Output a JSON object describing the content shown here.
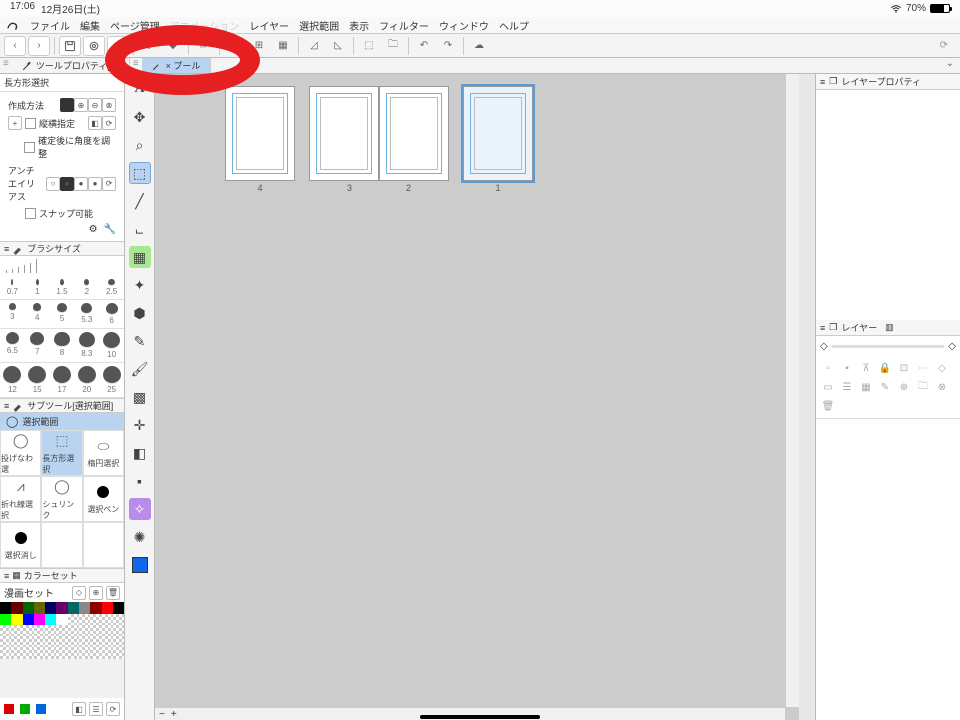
{
  "status": {
    "time": "17:06",
    "date": "12月26日(土)",
    "battery": "70%"
  },
  "menu": {
    "file": "ファイル",
    "edit": "編集",
    "page": "ページ管理",
    "anim": "アニメーション",
    "layer": "レイヤー",
    "select": "選択範囲",
    "view": "表示",
    "filter": "フィルター",
    "window": "ウィンドウ",
    "help": "ヘルプ"
  },
  "tabs": {
    "first": "ツールプロパティ[長",
    "second": "× プール"
  },
  "left": {
    "prop_title": "長方形選択",
    "method_label": "作成方法",
    "ratio_label": "縦横指定",
    "angle_label": "確定後に角度を調整",
    "aa_label": "アンチエイリアス",
    "snap_label": "スナップ可能",
    "brush_title": "ブラシサイズ",
    "sizes_txt": [
      "0.7",
      "1",
      "1.5",
      "2",
      "2.5",
      "3",
      "4",
      "5",
      "5.3",
      "6",
      "6.5",
      "7",
      "8",
      "8.3",
      "10",
      "12",
      "15",
      "17",
      "20",
      "25"
    ],
    "subtool_title": "サブツール[選択範囲]",
    "subtool_active": "選択範囲",
    "subtools": [
      "投げなわ選",
      "長方形選択",
      "楕円選択",
      "折れ線選択",
      "シュリンク",
      "選択ペン",
      "選択消し",
      "",
      ""
    ],
    "color_title": "カラーセット",
    "color_set": "漫画セット"
  },
  "pages": {
    "p1": "1",
    "p2": "2",
    "p3": "3",
    "p4": "4"
  },
  "right": {
    "layerprop": "レイヤープロパティ",
    "layer": "レイヤー"
  },
  "chart_data": null
}
